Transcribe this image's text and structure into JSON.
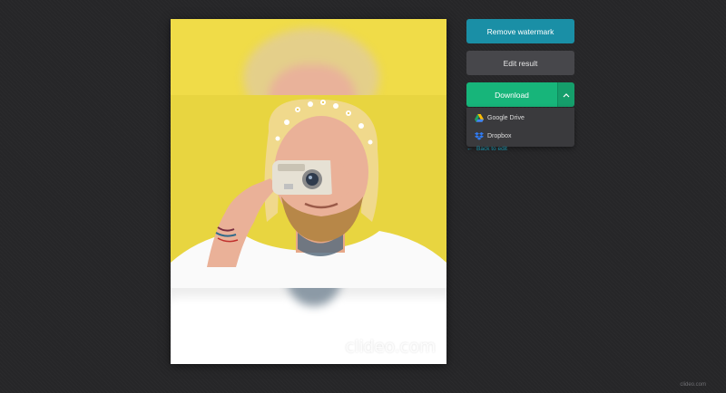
{
  "actions": {
    "remove_watermark_label": "Remove watermark",
    "edit_result_label": "Edit result",
    "download_label": "Download"
  },
  "download_menu": {
    "items": [
      {
        "label": "Google Drive",
        "icon": "google-drive-icon"
      },
      {
        "label": "Dropbox",
        "icon": "dropbox-icon"
      }
    ]
  },
  "back_link": {
    "label": "Back to edit",
    "icon": "arrow-left-icon"
  },
  "preview": {
    "watermark": "clideo.com"
  },
  "footer": {
    "text": "clideo.com"
  },
  "colors": {
    "accent_teal": "#1a8fa6",
    "download_green": "#17b57a",
    "background": "#262628"
  }
}
